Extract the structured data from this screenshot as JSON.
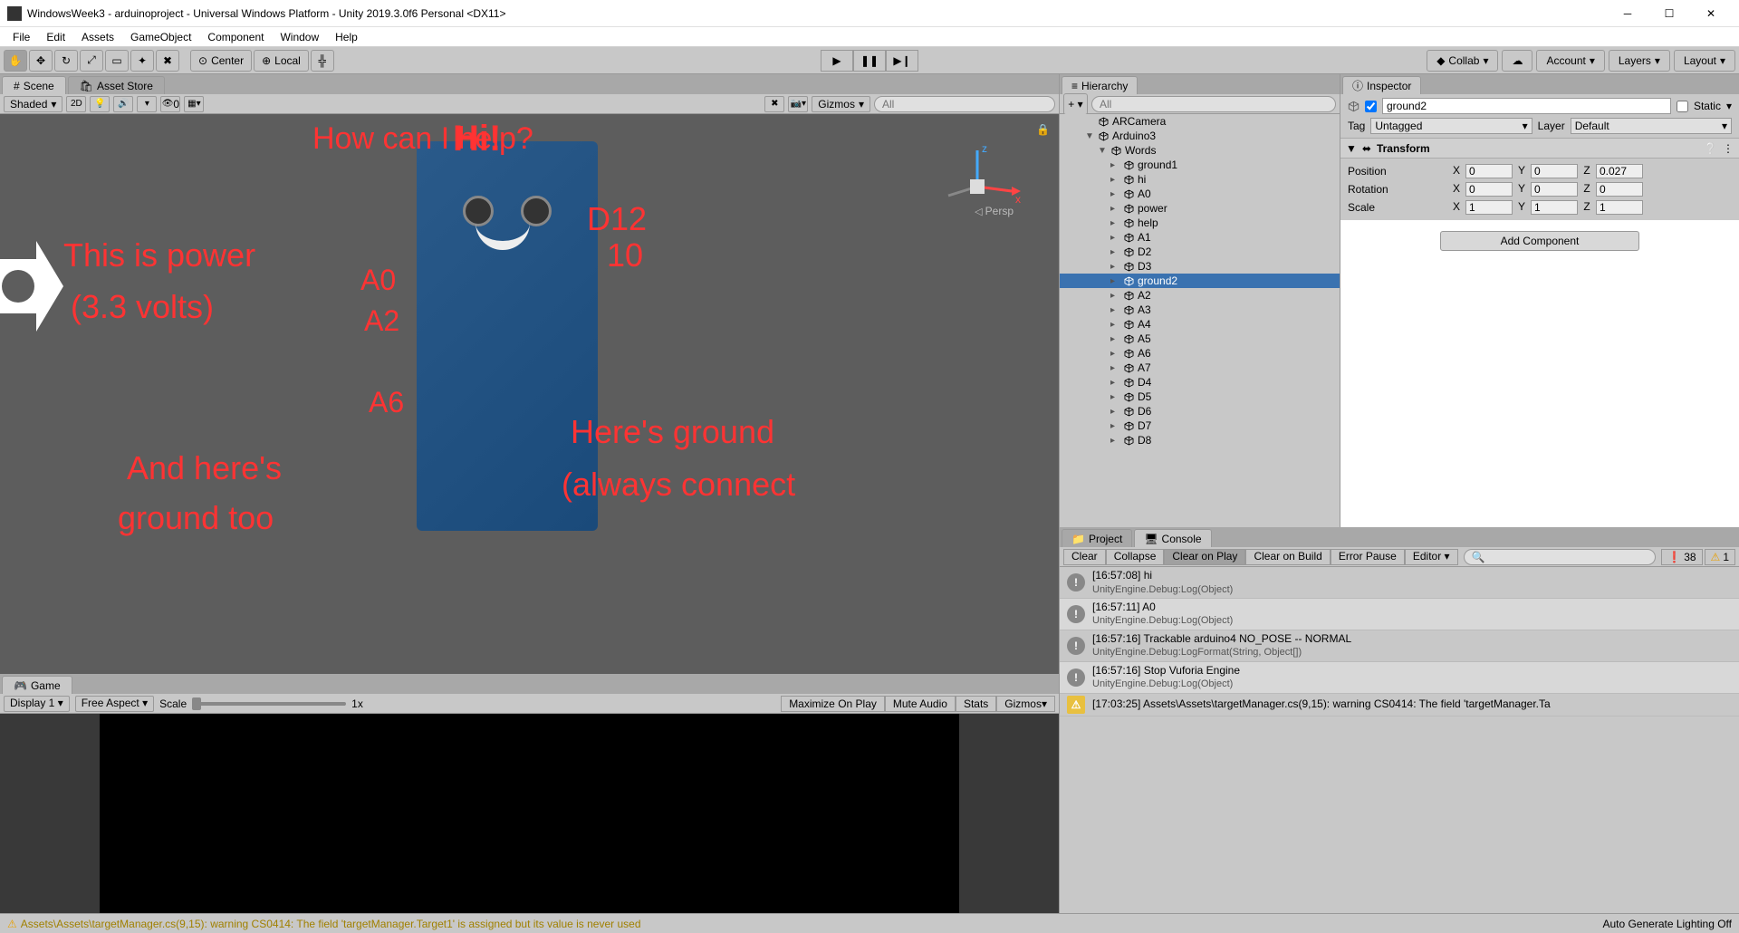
{
  "titlebar": "WindowsWeek3 - arduinoproject - Universal Windows Platform - Unity 2019.3.0f6 Personal <DX11>",
  "menus": [
    "File",
    "Edit",
    "Assets",
    "GameObject",
    "Component",
    "Window",
    "Help"
  ],
  "toolbar": {
    "pivot_center": "Center",
    "pivot_local": "Local",
    "collab": "Collab",
    "account": "Account",
    "layers": "Layers",
    "layout": "Layout"
  },
  "tabs": {
    "scene": "Scene",
    "asset_store": "Asset Store",
    "game": "Game"
  },
  "scene_toolbar": {
    "shaded": "Shaded",
    "mode_2d": "2D",
    "skybox_off": "0",
    "gizmos": "Gizmos",
    "search_ph": "All",
    "persp": "Persp"
  },
  "ar_texts": {
    "hi": "Hi!",
    "help": "How can I help?",
    "power1": "This is power",
    "power2": "(3.3 volts)",
    "d12": "D12",
    "d10": "10",
    "a0": "A0",
    "a2": "A2",
    "a6": "A6",
    "ground1": "Here's ground",
    "ground2": "(always connect",
    "andhere1": "And here's",
    "andhere2": "ground  too"
  },
  "game_toolbar": {
    "display": "Display 1",
    "aspect": "Free Aspect",
    "scale_label": "Scale",
    "scale_val": "1x",
    "maximize": "Maximize On Play",
    "mute": "Mute Audio",
    "stats": "Stats",
    "gizmos": "Gizmos"
  },
  "status": {
    "warning": "Assets\\Assets\\targetManager.cs(9,15): warning CS0414: The field 'targetManager.Target1' is assigned but its value is never used",
    "lighting": "Auto Generate Lighting Off"
  },
  "hierarchy": {
    "title": "Hierarchy",
    "search_ph": "All",
    "items": [
      {
        "name": "ARCamera",
        "depth": 2,
        "arrow": false
      },
      {
        "name": "Arduino3",
        "depth": 2,
        "arrow": true,
        "open": true
      },
      {
        "name": "Words",
        "depth": 3,
        "arrow": true,
        "open": true
      },
      {
        "name": "ground1",
        "depth": 4,
        "arrow": true
      },
      {
        "name": "hi",
        "depth": 4,
        "arrow": true
      },
      {
        "name": "A0",
        "depth": 4,
        "arrow": true
      },
      {
        "name": "power",
        "depth": 4,
        "arrow": true
      },
      {
        "name": "help",
        "depth": 4,
        "arrow": true
      },
      {
        "name": "A1",
        "depth": 4,
        "arrow": true
      },
      {
        "name": "D2",
        "depth": 4,
        "arrow": true
      },
      {
        "name": "D3",
        "depth": 4,
        "arrow": true
      },
      {
        "name": "ground2",
        "depth": 4,
        "arrow": true,
        "selected": true
      },
      {
        "name": "A2",
        "depth": 4,
        "arrow": true
      },
      {
        "name": "A3",
        "depth": 4,
        "arrow": true
      },
      {
        "name": "A4",
        "depth": 4,
        "arrow": true
      },
      {
        "name": "A5",
        "depth": 4,
        "arrow": true
      },
      {
        "name": "A6",
        "depth": 4,
        "arrow": true
      },
      {
        "name": "A7",
        "depth": 4,
        "arrow": true
      },
      {
        "name": "D4",
        "depth": 4,
        "arrow": true
      },
      {
        "name": "D5",
        "depth": 4,
        "arrow": true
      },
      {
        "name": "D6",
        "depth": 4,
        "arrow": true
      },
      {
        "name": "D7",
        "depth": 4,
        "arrow": true
      },
      {
        "name": "D8",
        "depth": 4,
        "arrow": true
      }
    ]
  },
  "inspector": {
    "title": "Inspector",
    "name": "ground2",
    "static_label": "Static",
    "tag_label": "Tag",
    "tag_value": "Untagged",
    "layer_label": "Layer",
    "layer_value": "Default",
    "transform": {
      "title": "Transform",
      "position": {
        "label": "Position",
        "x": "0",
        "y": "0",
        "z": "0.027"
      },
      "rotation": {
        "label": "Rotation",
        "x": "0",
        "y": "0",
        "z": "0"
      },
      "scale": {
        "label": "Scale",
        "x": "1",
        "y": "1",
        "z": "1"
      }
    },
    "add_component": "Add Component"
  },
  "console": {
    "project_tab": "Project",
    "console_tab": "Console",
    "clear": "Clear",
    "collapse": "Collapse",
    "clear_on_play": "Clear on Play",
    "clear_on_build": "Clear on Build",
    "error_pause": "Error Pause",
    "editor": "Editor",
    "info_count": "38",
    "warn_count": "1",
    "entries": [
      {
        "icon": "info",
        "main": "[16:57:08] hi",
        "sub": "UnityEngine.Debug:Log(Object)"
      },
      {
        "icon": "info",
        "main": "[16:57:11] A0",
        "sub": "UnityEngine.Debug:Log(Object)"
      },
      {
        "icon": "info",
        "main": "[16:57:16] Trackable arduino4 NO_POSE -- NORMAL",
        "sub": "UnityEngine.Debug:LogFormat(String, Object[])"
      },
      {
        "icon": "info",
        "main": "[16:57:16] Stop Vuforia Engine",
        "sub": "UnityEngine.Debug:Log(Object)"
      },
      {
        "icon": "warn",
        "main": "[17:03:25] Assets\\Assets\\targetManager.cs(9,15): warning CS0414: The field 'targetManager.Ta",
        "sub": ""
      }
    ]
  }
}
